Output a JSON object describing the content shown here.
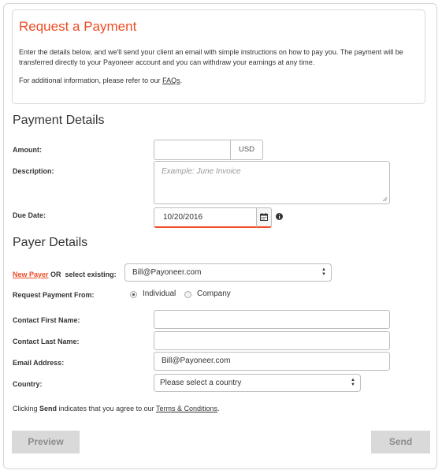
{
  "intro": {
    "title": "Request a Payment",
    "text": "Enter the details below, and we'll send your client an email with simple instructions on how to pay you. The payment will be transferred directly to your Payoneer account and you can withdraw your earnings at any time.",
    "info_prefix": "For additional information, please refer to our ",
    "faq_link": "FAQs",
    "info_suffix": "."
  },
  "payment_details": {
    "heading": "Payment Details",
    "amount_label": "Amount:",
    "amount_value": "",
    "currency": "USD",
    "description_label": "Description:",
    "description_placeholder": "Example: June Invoice",
    "due_date_label": "Due Date:",
    "due_date_value": "10/20/2016",
    "calendar_icon": "calendar-icon",
    "info_icon": "info-icon"
  },
  "payer_details": {
    "heading": "Payer Details",
    "new_payer_link": "New Payer",
    "or_select_label": "OR  select existing:",
    "existing_payer_value": "Bill@Payoneer.com",
    "request_from_label": "Request Payment From:",
    "option_individual": "Individual",
    "option_company": "Company",
    "selected_option": "Individual",
    "first_name_label": "Contact First Name:",
    "first_name_value": "",
    "last_name_label": "Contact Last Name:",
    "last_name_value": "",
    "email_label": "Email Address:",
    "email_value": "Bill@Payoneer.com",
    "country_label": "Country:",
    "country_value": "Please select a country"
  },
  "terms": {
    "prefix": "Clicking ",
    "send_word": "Send",
    "middle": " indicates that you agree to our ",
    "link": "Terms & Conditions",
    "suffix": "."
  },
  "buttons": {
    "preview": "Preview",
    "send": "Send"
  },
  "colors": {
    "accent": "#ee4c24",
    "disabled_button": "#d9d9d9"
  }
}
